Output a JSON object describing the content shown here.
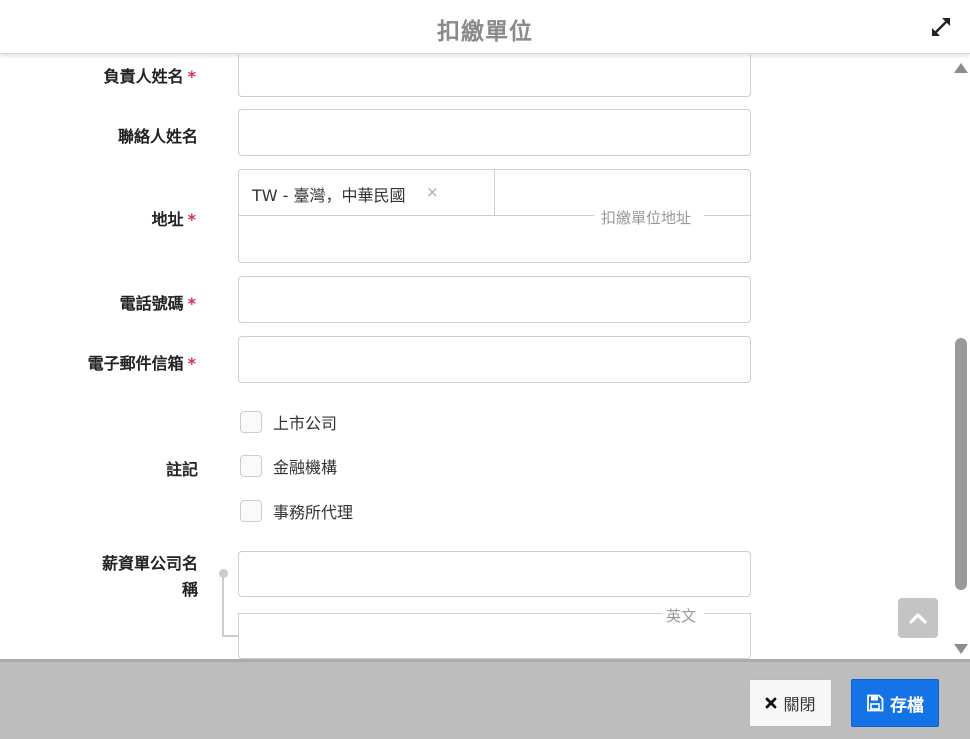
{
  "dialog": {
    "title": "扣繳單位"
  },
  "form": {
    "responsible_name": {
      "label": "負責人姓名",
      "required_mark": "*",
      "value": ""
    },
    "contact_name": {
      "label": "聯絡人姓名",
      "value": ""
    },
    "address": {
      "label": "地址",
      "required_mark": "*",
      "country_tag": "TW - 臺灣，中華民國",
      "country_remove": "×",
      "sub_label": "扣繳單位地址",
      "value": ""
    },
    "phone": {
      "label": "電話號碼",
      "required_mark": "*",
      "value": ""
    },
    "email": {
      "label": "電子郵件信箱",
      "required_mark": "*",
      "value": ""
    },
    "notes": {
      "label": "註記",
      "options": [
        {
          "label": "上市公司",
          "checked": false
        },
        {
          "label": "金融機構",
          "checked": false
        },
        {
          "label": "事務所代理",
          "checked": false
        }
      ]
    },
    "payslip_company_name": {
      "label_line1": "薪資單公司名",
      "label_line2": "稱",
      "value": "",
      "english_label": "英文",
      "english_value": ""
    }
  },
  "footer": {
    "close_label": "關閉",
    "save_label": "存檔"
  },
  "icons": {
    "expand": "expand-icon",
    "close": "close-x-icon",
    "save": "floppy-disk-icon",
    "back_to_top": "chevron-up-icon",
    "scroll_up": "triangle-up-icon",
    "scroll_down": "triangle-down-icon"
  },
  "colors": {
    "required": "#d2334d",
    "primary": "#1473e6",
    "footer_bg": "#bdbdbd"
  }
}
